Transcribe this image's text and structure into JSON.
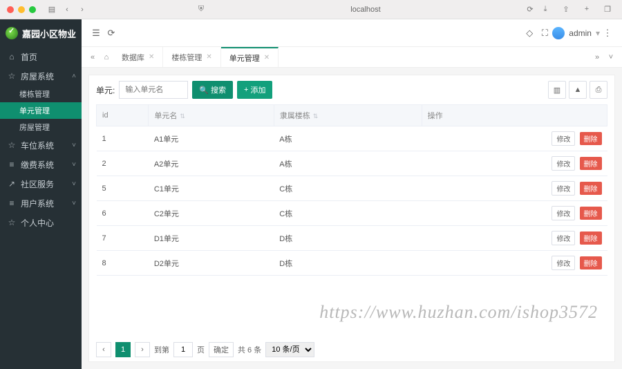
{
  "browser": {
    "addr": "localhost"
  },
  "brand": "嘉园小区物业",
  "user": "admin",
  "sidebar": [
    {
      "label": "首页",
      "icon": "⌂",
      "chev": "",
      "sub": []
    },
    {
      "label": "房屋系统",
      "icon": "☆",
      "chev": "˄",
      "sub": [
        {
          "label": "楼栋管理",
          "active": false
        },
        {
          "label": "单元管理",
          "active": true
        },
        {
          "label": "房屋管理",
          "active": false
        }
      ]
    },
    {
      "label": "车位系统",
      "icon": "☆",
      "chev": "˅",
      "sub": []
    },
    {
      "label": "缴费系统",
      "icon": "≡",
      "chev": "˅",
      "sub": []
    },
    {
      "label": "社区服务",
      "icon": "↗",
      "chev": "˅",
      "sub": []
    },
    {
      "label": "用户系统",
      "icon": "≡",
      "chev": "˅",
      "sub": []
    },
    {
      "label": "个人中心",
      "icon": "☆",
      "chev": "",
      "sub": []
    }
  ],
  "tabs": [
    {
      "label": "数据库",
      "active": false
    },
    {
      "label": "楼栋管理",
      "active": false
    },
    {
      "label": "单元管理",
      "active": true
    }
  ],
  "toolbar": {
    "label": "单元:",
    "placeholder": "输入单元名",
    "search": "搜索",
    "add": "添加"
  },
  "columns": {
    "id": "id",
    "name": "单元名",
    "building": "隶属楼栋",
    "op": "操作"
  },
  "ops": {
    "edit": "修改",
    "del": "删除"
  },
  "rows": [
    {
      "id": "1",
      "name": "A1单元",
      "building": "A栋"
    },
    {
      "id": "2",
      "name": "A2单元",
      "building": "A栋"
    },
    {
      "id": "5",
      "name": "C1单元",
      "building": "C栋"
    },
    {
      "id": "6",
      "name": "C2单元",
      "building": "C栋"
    },
    {
      "id": "7",
      "name": "D1单元",
      "building": "D栋"
    },
    {
      "id": "8",
      "name": "D2单元",
      "building": "D栋"
    }
  ],
  "pager": {
    "goto": "到第",
    "page_suffix": "页",
    "confirm": "确定",
    "total": "共 6 条",
    "per": "10 条/页",
    "current": "1",
    "input": "1"
  },
  "watermark": "https://www.huzhan.com/ishop3572"
}
